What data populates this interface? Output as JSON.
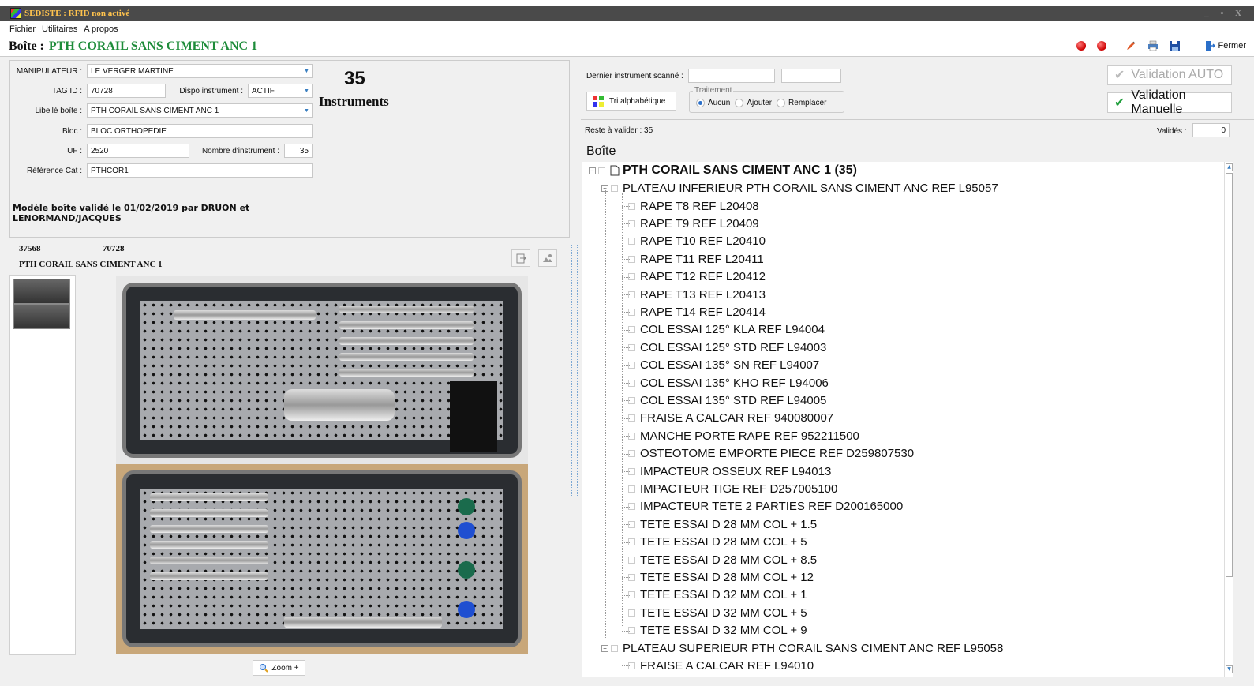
{
  "window": {
    "title": "SEDISTE : RFID non activé",
    "controls": "_ ▫ X"
  },
  "menu": {
    "items": [
      "Fichier",
      "Utilitaires",
      "A propos"
    ]
  },
  "box_bar": {
    "label": "Boîte :",
    "value": "PTH CORAIL SANS CIMENT ANC 1",
    "close_label": "Fermer"
  },
  "form": {
    "manipulateur_label": "MANIPULATEUR :",
    "manipulateur_value": "LE VERGER MARTINE",
    "tag_label": "TAG ID :",
    "tag_value": "70728",
    "dispo_label": "Dispo instrument :",
    "dispo_value": "ACTIF",
    "libelle_label": "Libellé boîte :",
    "libelle_value": "PTH CORAIL SANS CIMENT ANC 1",
    "bloc_label": "Bloc :",
    "bloc_value": "BLOC ORTHOPEDIE",
    "uf_label": "UF :",
    "uf_value": "2520",
    "nombre_label": "Nombre d'instrument :",
    "nombre_value": "35",
    "ref_label": "Référence Cat :",
    "ref_value": "PTHCOR1",
    "count": "35",
    "count_label": "Instruments",
    "modele_text": "Modèle boîte validé le 01/02/2019 par DRUON et LENORMAND/JACQUES"
  },
  "photo": {
    "id1": "37568",
    "id2": "70728",
    "name": "PTH CORAIL SANS CIMENT ANC 1",
    "zoom_label": "Zoom +"
  },
  "scan": {
    "last_label": "Dernier instrument scanné :",
    "tri_label": "Tri alphabétique",
    "traitement_legend": "Traitement",
    "radio_aucun": "Aucun",
    "radio_ajouter": "Ajouter",
    "radio_remplacer": "Remplacer",
    "val_auto": "Validation AUTO",
    "val_manuelle": "Validation Manuelle"
  },
  "status": {
    "reste_label": "Reste à valider : 35",
    "valides_label": "Validés :",
    "valides_value": "0"
  },
  "tree": {
    "header": "Boîte",
    "root": "PTH CORAIL SANS CIMENT ANC 1 (35)",
    "plateau1": "PLATEAU INFERIEUR PTH CORAIL SANS CIMENT ANC REF L95057",
    "items1": [
      "RAPE T8 REF L20408",
      "RAPE T9 REF L20409",
      "RAPE T10 REF L20410",
      "RAPE T11 REF L20411",
      "RAPE T12 REF L20412",
      "RAPE T13 REF L20413",
      "RAPE T14 REF L20414",
      "COL ESSAI 125° KLA REF L94004",
      "COL ESSAI 125° STD REF L94003",
      "COL ESSAI 135° SN REF L94007",
      "COL ESSAI 135° KHO REF L94006",
      "COL ESSAI 135° STD REF L94005",
      "FRAISE A CALCAR REF 940080007",
      "MANCHE PORTE RAPE REF 952211500",
      "OSTEOTOME EMPORTE PIECE REF D259807530",
      "IMPACTEUR OSSEUX REF L94013",
      "IMPACTEUR TIGE REF D257005100",
      "IMPACTEUR TETE 2 PARTIES REF D200165000",
      "TETE ESSAI D 28 MM COL + 1.5",
      "TETE ESSAI D 28 MM COL + 5",
      "TETE ESSAI D 28 MM COL + 8.5",
      "TETE ESSAI D 28 MM COL + 12",
      "TETE ESSAI D 32 MM COL + 1",
      "TETE ESSAI D 32 MM COL + 5",
      "TETE ESSAI D 32 MM COL + 9"
    ],
    "plateau2": "PLATEAU SUPERIEUR PTH CORAIL SANS CIMENT ANC REF L95058",
    "items2": [
      "FRAISE A CALCAR REF L94010"
    ]
  },
  "icons": {
    "tri": "sort-icon",
    "check": "check-icon",
    "zoom": "magnifier-icon",
    "fermer": "exit-door-icon"
  },
  "colors": {
    "title_green": "#1e8c3a",
    "check_green": "#1e9e3a",
    "status_red": "#cc0000"
  }
}
